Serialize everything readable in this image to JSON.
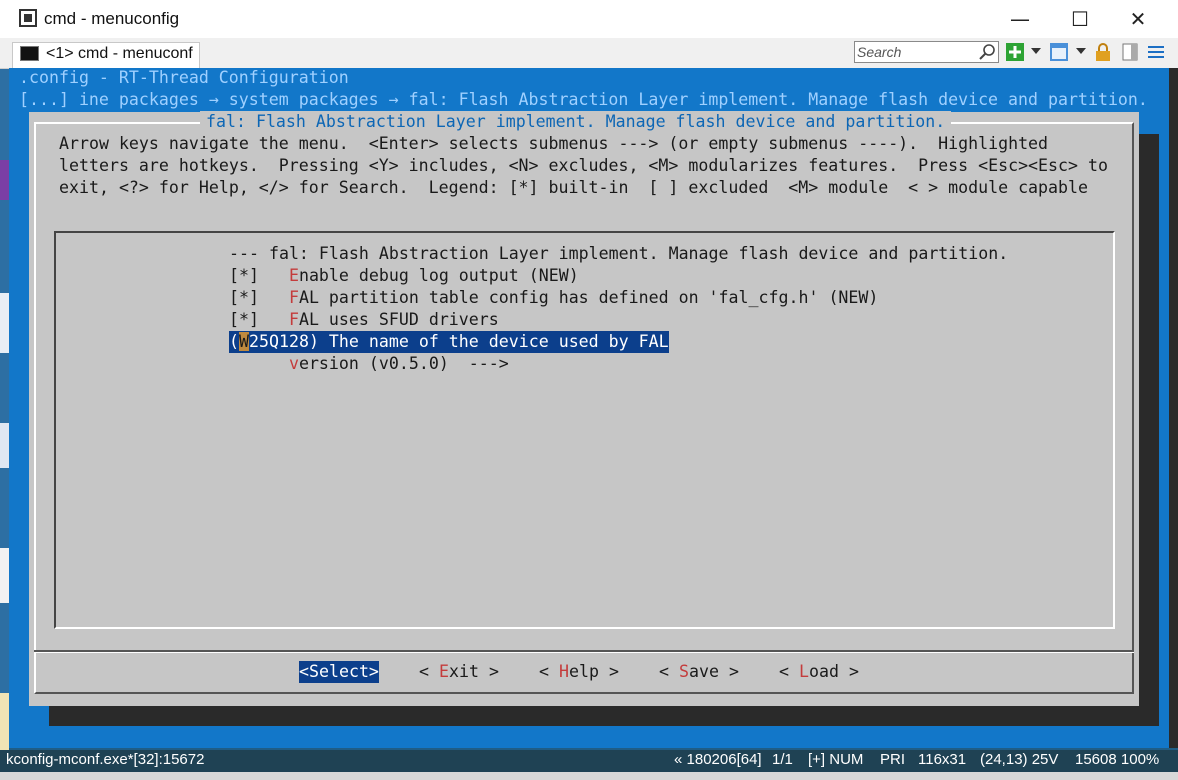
{
  "window": {
    "title": "cmd - menuconfig",
    "tab_label": "<1> cmd - menuconf",
    "minimize": "—",
    "maximize": "☐",
    "close": "✕",
    "search_placeholder": "Search"
  },
  "terminal": {
    "config_title": ".config - RT-Thread Configuration",
    "breadcrumb": "[...] ine packages → system packages → fal: Flash Abstraction Layer implement. Manage flash device and partition.",
    "dialog_title": "fal: Flash Abstraction Layer implement. Manage flash device and partition.",
    "help_lines": [
      "Arrow keys navigate the menu.  <Enter> selects submenus ---> (or empty submenus ----).  Highlighted",
      "letters are hotkeys.  Pressing <Y> includes, <N> excludes, <M> modularizes features.  Press <Esc><Esc> to",
      "exit, <?> for Help, </> for Search.  Legend: [*] built-in  [ ] excluded  <M> module  < > module capable"
    ],
    "menu_header": "--- fal: Flash Abstraction Layer implement. Manage flash device and partition.",
    "menu_items": [
      {
        "prefix": "[*]   ",
        "hotkey": "E",
        "rest": "nable debug log output (NEW)"
      },
      {
        "prefix": "[*]   ",
        "hotkey": "F",
        "rest": "AL partition table config has defined on 'fal_cfg.h' (NEW)"
      },
      {
        "prefix": "[*]   ",
        "hotkey": "F",
        "rest": "AL uses SFUD drivers"
      }
    ],
    "selected_item": {
      "open": "(",
      "cursor": "W",
      "rest": "25Q128) The name of the device used by FAL"
    },
    "version_item": {
      "prefix": "      ",
      "hotkey": "v",
      "rest": "ersion (v0.5.0)  --->"
    },
    "buttons": {
      "select": "<Select>",
      "exit_pre": "< ",
      "exit_hk": "E",
      "exit_rest": "xit >",
      "help_pre": "< ",
      "help_hk": "H",
      "help_rest": "elp >",
      "save_pre": "< ",
      "save_hk": "S",
      "save_rest": "ave >",
      "load_pre": "< ",
      "load_hk": "L",
      "load_rest": "oad >"
    }
  },
  "status_bar": {
    "process": "kconfig-mconf.exe*[32]:15672",
    "buffer": "« 180206[64]",
    "page": "1/1",
    "mode": "[+] NUM",
    "priority": "PRI",
    "size": "116x31",
    "position": "(24,13) 25V",
    "pid_pct": "15608 100%"
  },
  "colors": {
    "terminal_bg": "#1277c9",
    "dialog_bg": "#c6c6c6",
    "highlight": "#0c3f8c",
    "hotkey": "#c43c3c",
    "title_accent": "#0c66b5"
  }
}
